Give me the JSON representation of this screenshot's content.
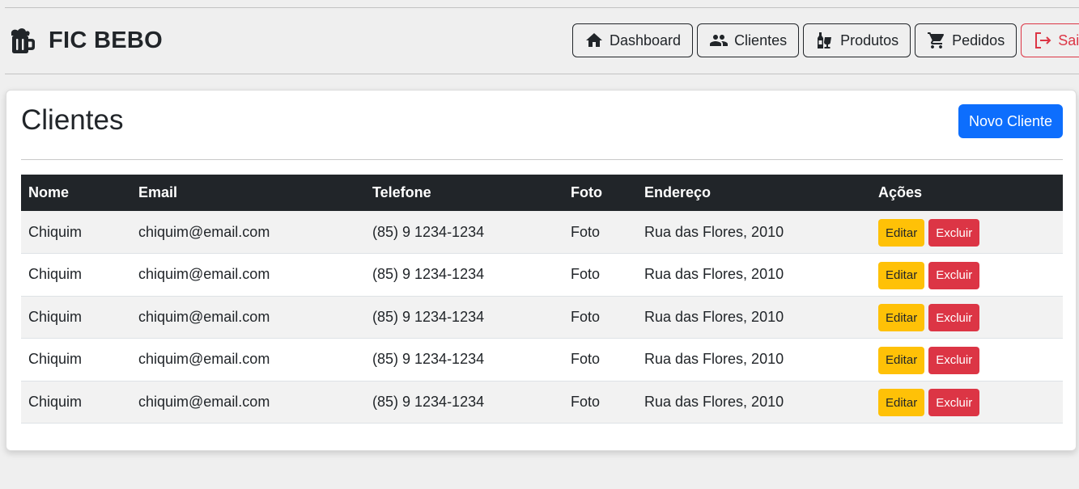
{
  "brand": {
    "name": "FIC BEBO",
    "icon": "beer-mug-icon"
  },
  "nav": {
    "dashboard": {
      "label": "Dashboard",
      "icon": "home-icon"
    },
    "clientes": {
      "label": "Clientes",
      "icon": "users-icon"
    },
    "produtos": {
      "label": "Produtos",
      "icon": "bottles-icon"
    },
    "pedidos": {
      "label": "Pedidos",
      "icon": "cart-icon"
    },
    "sair": {
      "label": "Sair",
      "icon": "logout-icon"
    }
  },
  "page": {
    "title": "Clientes",
    "new_button": "Novo Cliente"
  },
  "table": {
    "headers": {
      "nome": "Nome",
      "email": "Email",
      "telefone": "Telefone",
      "foto": "Foto",
      "endereco": "Endereço",
      "acoes": "Ações"
    },
    "rows": [
      {
        "nome": "Chiquim",
        "email": "chiquim@email.com",
        "telefone": "(85) 9 1234-1234",
        "foto": "Foto",
        "endereco": "Rua das Flores, 2010",
        "edit": "Editar",
        "delete": "Excluir"
      },
      {
        "nome": "Chiquim",
        "email": "chiquim@email.com",
        "telefone": "(85) 9 1234-1234",
        "foto": "Foto",
        "endereco": "Rua das Flores, 2010",
        "edit": "Editar",
        "delete": "Excluir"
      },
      {
        "nome": "Chiquim",
        "email": "chiquim@email.com",
        "telefone": "(85) 9 1234-1234",
        "foto": "Foto",
        "endereco": "Rua das Flores, 2010",
        "edit": "Editar",
        "delete": "Excluir"
      },
      {
        "nome": "Chiquim",
        "email": "chiquim@email.com",
        "telefone": "(85) 9 1234-1234",
        "foto": "Foto",
        "endereco": "Rua das Flores, 2010",
        "edit": "Editar",
        "delete": "Excluir"
      },
      {
        "nome": "Chiquim",
        "email": "chiquim@email.com",
        "telefone": "(85) 9 1234-1234",
        "foto": "Foto",
        "endereco": "Rua das Flores, 2010",
        "edit": "Editar",
        "delete": "Excluir"
      }
    ]
  },
  "colors": {
    "primary": "#0d6efd",
    "warning": "#ffc107",
    "danger": "#dc3545",
    "dark": "#212529",
    "background": "#efefef"
  }
}
